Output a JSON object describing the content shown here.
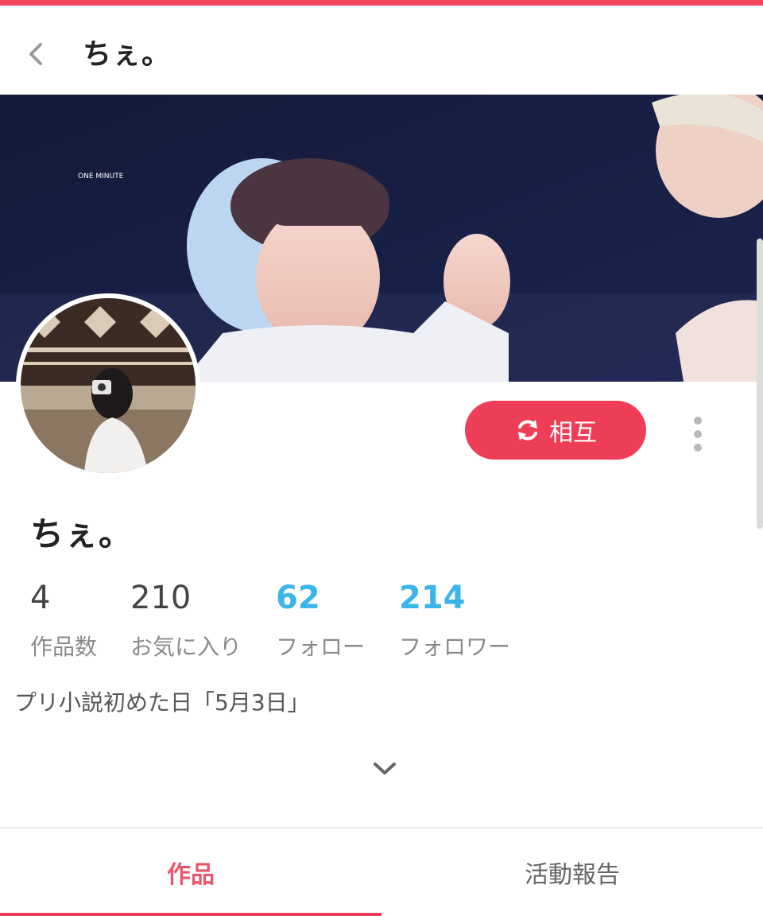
{
  "header": {
    "title": "ちぇ。"
  },
  "banner": {
    "caption": "ONE MINUTE"
  },
  "actions": {
    "mutual_label": "相互"
  },
  "profile": {
    "name": "ちぇ。",
    "bio": "プリ小説初めた日「5月3日」"
  },
  "stats": [
    {
      "value": "4",
      "label": "作品数"
    },
    {
      "value": "210",
      "label": "お気に入り"
    },
    {
      "value": "62",
      "label": "フォロー"
    },
    {
      "value": "214",
      "label": "フォロワー"
    }
  ],
  "tabs": [
    {
      "label": "作品",
      "active": true
    },
    {
      "label": "活動報告",
      "active": false
    }
  ],
  "colors": {
    "accent": "#ee3e57",
    "link": "#3bb4e8"
  }
}
